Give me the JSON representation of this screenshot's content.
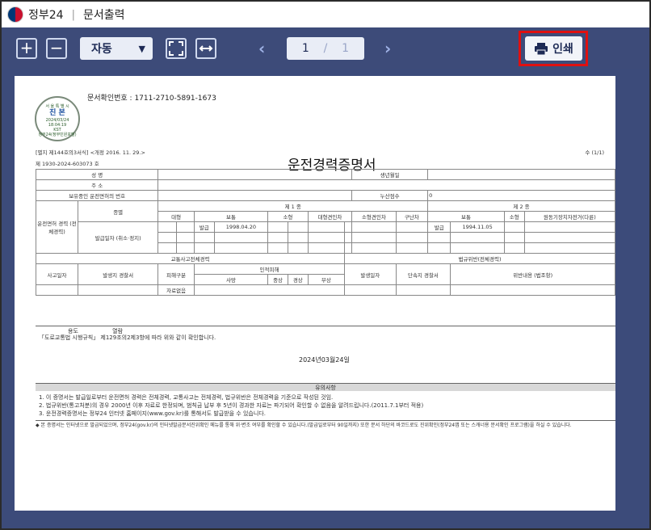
{
  "titlebar": {
    "app_name": "정부24",
    "separator": "|",
    "title": "문서출력"
  },
  "toolbar": {
    "zoom_in": "+",
    "zoom_out": "−",
    "zoom_value": "자동",
    "prev": "‹",
    "next": "›",
    "current_page": "1",
    "page_sep": "/",
    "total_pages": "1",
    "print_label": "인쇄",
    "highlight_color": "#e01010"
  },
  "document": {
    "doc_number_label": "문서확인번호 :",
    "doc_number": "1711-2710-5891-1673",
    "seal": {
      "top": "서 울 특 별 시",
      "main": "진 본",
      "date": "2024/03/24",
      "time": "18:04:19",
      "tz": "KST",
      "bottom": "정부24(정부민원포털)"
    },
    "law_ref": "[별지 제144호의3서식] <개정 2016. 11. 29.>",
    "page_count": "수 (1/1)",
    "cert_no": "제 1930-2024-603073 호",
    "title": "운전경력증명서",
    "form": {
      "name": "성 명",
      "birth": "생년월일",
      "address": "주 소",
      "license_held": "보유중인 운전면허의 번호",
      "points": "누산점수",
      "points_value": "0",
      "driving_record": "운전면허 경력 (전체경력)",
      "type": "종별",
      "class1": "제 1 종",
      "class2": "제 2 종",
      "c1_large": "대형",
      "c1_normal": "보통",
      "c1_small": "소형",
      "c1_trailer": "대형견인차",
      "c1_small_trailer": "소형견인차",
      "c1_wrecker": "구난차",
      "c2_normal": "보통",
      "c2_small": "소형",
      "c2_moped": "원동기장치자전거(다륜)",
      "issue_label": "발급",
      "c1_date": "1998.04.20",
      "c2_date": "1994.11.05",
      "issue_date_label": "발급일자 (취소·정지)",
      "accident_record": "교통사고전체경력",
      "violation_record": "법규위반(전체경력)",
      "accident_date": "사고일자",
      "police_station": "발생지 경찰서",
      "victim_type": "피해구분",
      "casualties": "인적피해",
      "death": "사망",
      "serious": "중상",
      "minor": "경상",
      "injury": "부상",
      "violation_date": "발생일자",
      "enforcing_station": "단속지 경찰서",
      "violation_detail": "위반내용 (법조항)",
      "no_record": "자료없음"
    },
    "purpose_label": "용도",
    "purpose_value": "열람",
    "rule_line": "「도로교통법 시행규칙」 제129조의2제3항에 따라 위와 같이 확인합니다.",
    "issue_date": "2024년03월24일",
    "notice_title": "유의사항",
    "notice_1": "1. 이 증명서는 발급일로부터 운전면허 경력은 전체경력, 교통사고는 전체경력, 법규위반은 전체경력을 기준으로 작성된 것임.",
    "notice_2": "2. 법규위반(통고처분)의 경우 2000년 이후 자료로 한정되며, 범칙금 납부 후 5년이 경과한 자료는 파기되어 확인할 수 없음을 알려드립니다.(2011.7.1부터 적용)",
    "notice_3": "3. 운전경력증명서는 정부24 인터넷 홈페이지(www.gov.kr)를 통해서도 발급받을 수 있습니다.",
    "footer_note": "◆ 본 증명서는 인터넷으로 발급되었으며, 정부24(gov.kr)의 인터넷발급문서진위확인 메뉴를 통해 위·변조 여부를 확인할 수 있습니다.(발급일로부터 90일까지) 또한 문서 하단의 바코드로도 진위확인(정부24앱 또는 스캐너용 문서확인 프로그램)을 하실 수 있습니다."
  }
}
